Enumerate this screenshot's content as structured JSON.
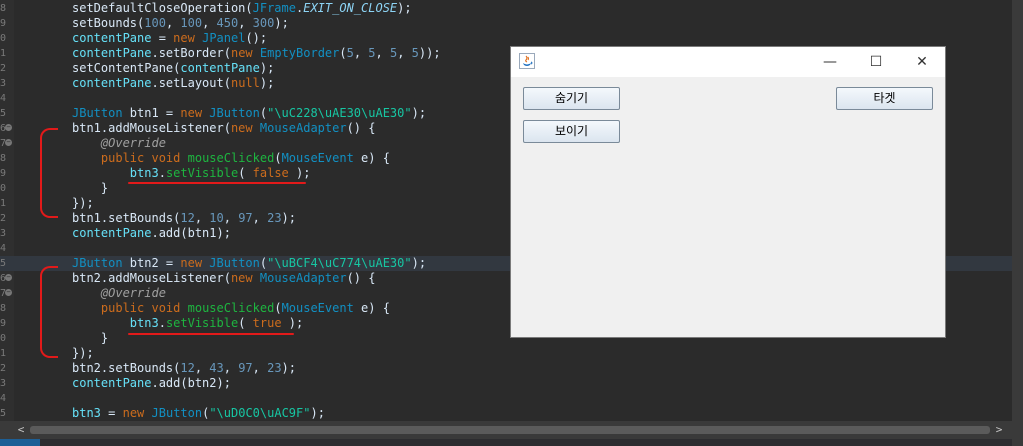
{
  "editor": {
    "lines": [
      {
        "n": "8",
        "fold": false,
        "current": false,
        "html": "setDefaultCloseOperation(<span class=\"ty\">JFrame</span>.<span class=\"it\">EXIT_ON_CLOSE</span>);"
      },
      {
        "n": "9",
        "fold": false,
        "current": false,
        "html": "setBounds(<span class=\"mn\">100</span>, <span class=\"mn\">100</span>, <span class=\"mn\">450</span>, <span class=\"mn\">300</span>);"
      },
      {
        "n": "0",
        "fold": false,
        "current": false,
        "html": "<span class=\"fd\">contentPane</span> = <span class=\"kw\">new</span> <span class=\"ty\">JPanel</span>();"
      },
      {
        "n": "1",
        "fold": false,
        "current": false,
        "html": "<span class=\"fd\">contentPane</span>.setBorder(<span class=\"kw\">new</span> <span class=\"ty\">EmptyBorder</span>(<span class=\"mn\">5</span>, <span class=\"mn\">5</span>, <span class=\"mn\">5</span>, <span class=\"mn\">5</span>));"
      },
      {
        "n": "2",
        "fold": false,
        "current": false,
        "html": "setContentPane(<span class=\"fd\">contentPane</span>);"
      },
      {
        "n": "3",
        "fold": false,
        "current": false,
        "html": "<span class=\"fd\">contentPane</span>.setLayout(<span class=\"kw\">null</span>);"
      },
      {
        "n": "4",
        "fold": false,
        "current": false,
        "html": ""
      },
      {
        "n": "5",
        "fold": false,
        "current": false,
        "html": "<span class=\"ty\">JButton</span> btn1 = <span class=\"kw\">new</span> <span class=\"ty\">JButton</span>(<span class=\"st\">\"\\uC228\\uAE30\\uAE30\"</span>);"
      },
      {
        "n": "6",
        "fold": true,
        "current": false,
        "html": "btn1.addMouseListener(<span class=\"kw\">new</span> <span class=\"ty\">MouseAdapter</span>() {"
      },
      {
        "n": "7",
        "fold": true,
        "current": false,
        "html": "    <span class=\"an\">@Override</span>"
      },
      {
        "n": "8",
        "fold": false,
        "current": false,
        "html": "    <span class=\"kw\">public void</span> <span class=\"fn\">mouseClicked</span>(<span class=\"ty\">MouseEvent</span> e) {"
      },
      {
        "n": "9",
        "fold": false,
        "current": false,
        "html": "        <span class=\"fd\">btn3</span>.<span class=\"fn\">setVisible</span>( <span class=\"kw\">false</span> );"
      },
      {
        "n": "0",
        "fold": false,
        "current": false,
        "html": "    }"
      },
      {
        "n": "1",
        "fold": false,
        "current": false,
        "html": "});"
      },
      {
        "n": "2",
        "fold": false,
        "current": false,
        "html": "btn1.setBounds(<span class=\"mn\">12</span>, <span class=\"mn\">10</span>, <span class=\"mn\">97</span>, <span class=\"mn\">23</span>);"
      },
      {
        "n": "3",
        "fold": false,
        "current": false,
        "html": "<span class=\"fd\">contentPane</span>.add(btn1);"
      },
      {
        "n": "4",
        "fold": false,
        "current": false,
        "html": ""
      },
      {
        "n": "5",
        "fold": false,
        "current": true,
        "html": "<span class=\"ty\">JButton</span> btn2 = <span class=\"kw\">new</span> <span class=\"ty\">JButton</span>(<span class=\"st\">\"\\uBCF4\\uC774\\uAE30\"</span>);"
      },
      {
        "n": "6",
        "fold": true,
        "current": false,
        "html": "btn2.addMouseListener(<span class=\"kw\">new</span> <span class=\"ty\">MouseAdapter</span>() {"
      },
      {
        "n": "7",
        "fold": true,
        "current": false,
        "html": "    <span class=\"an\">@Override</span>"
      },
      {
        "n": "8",
        "fold": false,
        "current": false,
        "html": "    <span class=\"kw\">public void</span> <span class=\"fn\">mouseClicked</span>(<span class=\"ty\">MouseEvent</span> e) {"
      },
      {
        "n": "9",
        "fold": false,
        "current": false,
        "html": "        <span class=\"fd\">btn3</span>.<span class=\"fn\">setVisible</span>( <span class=\"kw\">true</span> );"
      },
      {
        "n": "0",
        "fold": false,
        "current": false,
        "html": "    }"
      },
      {
        "n": "1",
        "fold": false,
        "current": false,
        "html": "});"
      },
      {
        "n": "2",
        "fold": false,
        "current": false,
        "html": "btn2.setBounds(<span class=\"mn\">12</span>, <span class=\"mn\">43</span>, <span class=\"mn\">97</span>, <span class=\"mn\">23</span>);"
      },
      {
        "n": "3",
        "fold": false,
        "current": false,
        "html": "<span class=\"fd\">contentPane</span>.add(btn2);"
      },
      {
        "n": "4",
        "fold": false,
        "current": false,
        "html": ""
      },
      {
        "n": "5",
        "fold": false,
        "current": false,
        "html": "<span class=\"fd\">btn3</span> = <span class=\"kw\">new</span> <span class=\"ty\">JButton</span>(<span class=\"st\">\"\\uD0C0\\uAC9F\"</span>);"
      }
    ]
  },
  "scrollbar": {
    "left_arrow": "<",
    "right_arrow": ">"
  },
  "window": {
    "title": "",
    "icon": "java-coffee-cup-icon",
    "minimize_glyph": "—",
    "maximize_glyph": "☐",
    "close_glyph": "✕",
    "buttons": {
      "hide": "숨기기",
      "show": "보이기",
      "target": "타겟"
    }
  },
  "colors": {
    "editor_bg": "#2b2b2b",
    "annotation_red": "#e21a1a"
  }
}
